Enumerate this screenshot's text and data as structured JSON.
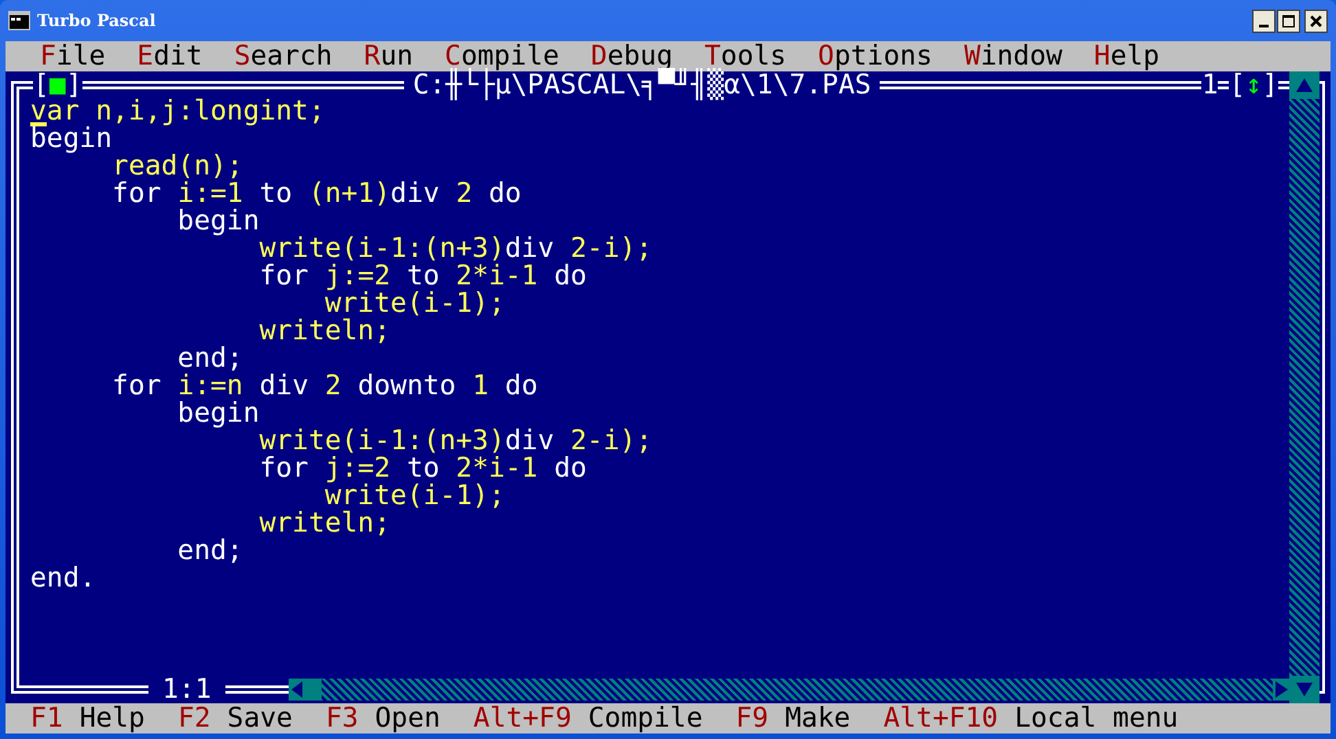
{
  "window": {
    "title": "Turbo Pascal"
  },
  "menu": [
    {
      "label": "File"
    },
    {
      "label": "Edit"
    },
    {
      "label": "Search"
    },
    {
      "label": "Run"
    },
    {
      "label": "Compile"
    },
    {
      "label": "Debug"
    },
    {
      "label": "Tools"
    },
    {
      "label": "Options"
    },
    {
      "label": "Window"
    },
    {
      "label": "Help"
    }
  ],
  "editor": {
    "close": "[■]",
    "title": "C:╫└├µ\\PASCAL\\╕▀╜╢▒α\\1\\7.PAS",
    "number": "1",
    "zoom": "[↕]",
    "position": "1:1",
    "lines": [
      [
        {
          "text": "var n,i,j:longint;",
          "kind": "ident"
        }
      ],
      [
        {
          "text": "begin",
          "kind": "keyword"
        }
      ],
      [
        {
          "text": "     read(n);",
          "kind": "ident"
        }
      ],
      [
        {
          "text": "     for",
          "kind": "keyword"
        },
        {
          "text": " i:=1 ",
          "kind": "ident"
        },
        {
          "text": "to",
          "kind": "keyword"
        },
        {
          "text": " (n+1)",
          "kind": "ident"
        },
        {
          "text": "div",
          "kind": "keyword"
        },
        {
          "text": " 2 ",
          "kind": "ident"
        },
        {
          "text": "do",
          "kind": "keyword"
        }
      ],
      [
        {
          "text": "         begin",
          "kind": "keyword"
        }
      ],
      [
        {
          "text": "              write(i-1:(n+3)",
          "kind": "ident"
        },
        {
          "text": "div",
          "kind": "keyword"
        },
        {
          "text": " 2-i);",
          "kind": "ident"
        }
      ],
      [
        {
          "text": "              for",
          "kind": "keyword"
        },
        {
          "text": " j:=2 ",
          "kind": "ident"
        },
        {
          "text": "to",
          "kind": "keyword"
        },
        {
          "text": " 2*i-1 ",
          "kind": "ident"
        },
        {
          "text": "do",
          "kind": "keyword"
        }
      ],
      [
        {
          "text": "                  write(i-1);",
          "kind": "ident"
        }
      ],
      [
        {
          "text": "              writeln;",
          "kind": "ident"
        }
      ],
      [
        {
          "text": "         end;",
          "kind": "keyword"
        }
      ],
      [
        {
          "text": "     for",
          "kind": "keyword"
        },
        {
          "text": " i:=n ",
          "kind": "ident"
        },
        {
          "text": "div",
          "kind": "keyword"
        },
        {
          "text": " 2 ",
          "kind": "ident"
        },
        {
          "text": "downto",
          "kind": "keyword"
        },
        {
          "text": " 1 ",
          "kind": "ident"
        },
        {
          "text": "do",
          "kind": "keyword"
        }
      ],
      [
        {
          "text": "         begin",
          "kind": "keyword"
        }
      ],
      [
        {
          "text": "              write(i-1:(n+3)",
          "kind": "ident"
        },
        {
          "text": "div",
          "kind": "keyword"
        },
        {
          "text": " 2-i);",
          "kind": "ident"
        }
      ],
      [
        {
          "text": "              for",
          "kind": "keyword"
        },
        {
          "text": " j:=2 ",
          "kind": "ident"
        },
        {
          "text": "to",
          "kind": "keyword"
        },
        {
          "text": " 2*i-1 ",
          "kind": "ident"
        },
        {
          "text": "do",
          "kind": "keyword"
        }
      ],
      [
        {
          "text": "                  write(i-1);",
          "kind": "ident"
        }
      ],
      [
        {
          "text": "              writeln;",
          "kind": "ident"
        }
      ],
      [
        {
          "text": "         end;",
          "kind": "keyword"
        }
      ],
      [
        {
          "text": "end.",
          "kind": "keyword"
        }
      ]
    ]
  },
  "status_bar": [
    {
      "key": "F1",
      "label": "Help"
    },
    {
      "key": "F2",
      "label": "Save"
    },
    {
      "key": "F3",
      "label": "Open"
    },
    {
      "key": "Alt+F9",
      "label": "Compile"
    },
    {
      "key": "F9",
      "label": "Make"
    },
    {
      "key": "Alt+F10",
      "label": "Local menu"
    }
  ]
}
